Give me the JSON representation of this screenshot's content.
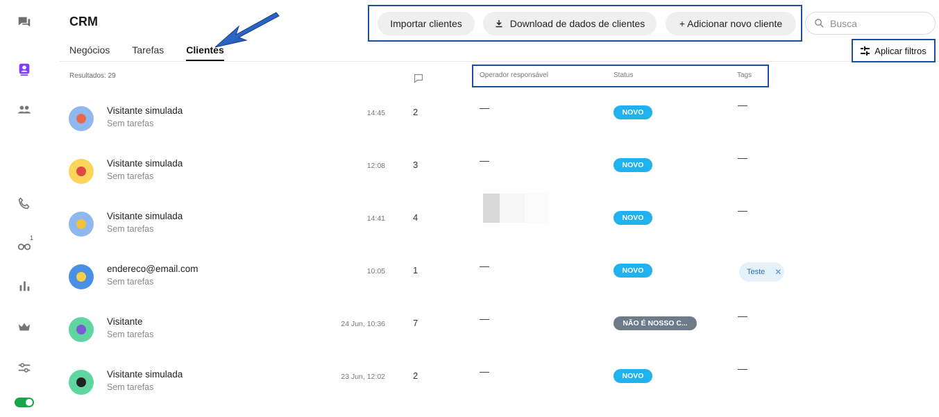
{
  "header": {
    "title": "CRM",
    "tabs": [
      {
        "label": "Negócios"
      },
      {
        "label": "Tarefas"
      },
      {
        "label": "Clientes"
      }
    ],
    "actions": {
      "import_label": "Importar clientes",
      "download_label": "Download de dados de clientes",
      "add_label": "+ Adicionar novo cliente"
    },
    "search": {
      "placeholder": "Busca"
    },
    "filter_label": "Aplicar filtros"
  },
  "sidebar": {
    "badge_count": "1"
  },
  "table": {
    "results_label": "Resultados: 29",
    "columns": {
      "operator": "Operador responsável",
      "status": "Status",
      "tags": "Tags"
    },
    "empty_value": "—",
    "rows": [
      {
        "name": "Visitante simulada",
        "tasks": "Sem tarefas",
        "time": "14:45",
        "count": "2",
        "status": "NOVO"
      },
      {
        "name": "Visitante simulada",
        "tasks": "Sem tarefas",
        "time": "12:08",
        "count": "3",
        "status": "NOVO"
      },
      {
        "name": "Visitante simulada",
        "tasks": "Sem tarefas",
        "time": "14:41",
        "count": "4",
        "status": "NOVO"
      },
      {
        "name": "endereco@email.com",
        "tasks": "Sem tarefas",
        "time": "10:05",
        "count": "1",
        "status": "NOVO",
        "tag": "Teste"
      },
      {
        "name": "Visitante",
        "tasks": "Sem tarefas",
        "time": "24 Jun, 10:36",
        "count": "7",
        "status": "NÃO É NOSSO C..."
      },
      {
        "name": "Visitante simulada",
        "tasks": "Sem tarefas",
        "time": "23 Jun, 12:02",
        "count": "2",
        "status": "NOVO"
      }
    ]
  },
  "colors": {
    "accent_purple": "#7e3ff2",
    "status_novo": "#1fb2ef",
    "status_other": "#6c7a8a",
    "annotation_blue": "#1d4f9c",
    "toggle_green": "#1aa54a"
  }
}
